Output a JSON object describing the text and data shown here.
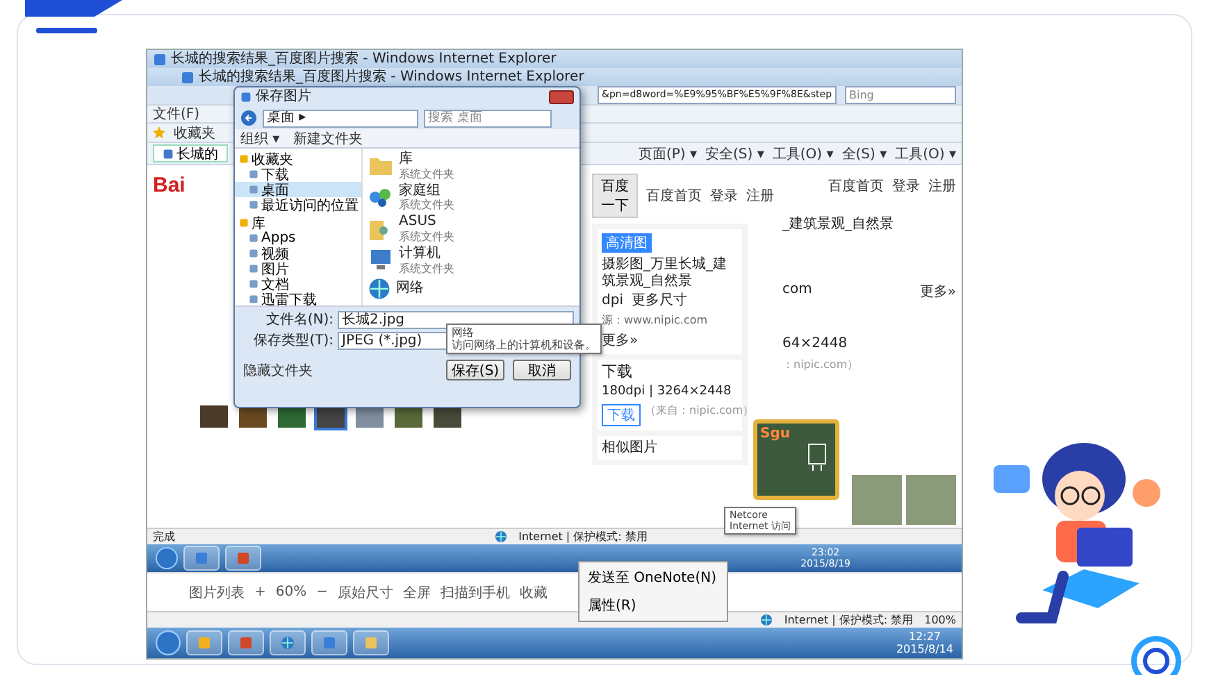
{
  "browser": {
    "titles": [
      "长城的搜索结果_百度图片搜索 - Windows Internet Explorer",
      "长城的搜索结果_百度图片搜索 - Windows Internet Explorer"
    ],
    "address": "&pn=d8word=%E9%95%BF%E5%9F%8E&step",
    "search_placeholder": "Bing",
    "menu": [
      "文件(F)"
    ],
    "favorites": "收藏夹",
    "tab": "长城的",
    "commands": [
      "页面(P) ▾",
      "安全(S) ▾",
      "工具(O) ▾"
    ],
    "commands_2": [
      "全(S) ▾",
      "工具(O) ▾"
    ]
  },
  "baidu": {
    "logo": "Bai",
    "search_button": "百度一下",
    "links": [
      "百度首页",
      "登录",
      "注册"
    ],
    "links_2": [
      "百度首页",
      "登录",
      "注册"
    ]
  },
  "thumbnails": [
    {
      "selected": false
    },
    {
      "selected": false
    },
    {
      "selected": false
    },
    {
      "selected": true
    },
    {
      "selected": false
    },
    {
      "selected": false
    },
    {
      "selected": false
    }
  ],
  "detail": {
    "badge": "高清图",
    "title": "摄影图_万里长城_建筑景观_自然景",
    "meta": [
      "dpi",
      "更多尺寸"
    ],
    "source": "源：www.nipic.com",
    "more": "更多»",
    "download_heading": "下载",
    "specs": "180dpi | 3264×2448",
    "download_button": "下载",
    "from": "（来自：nipic.com）",
    "similar": "相似图片"
  },
  "right_panel": {
    "title": "_建筑景观_自然景",
    "source": "com",
    "more": "更多»",
    "specs": "64×2448",
    "from": "：nipic.com）"
  },
  "widget": {
    "logo": "Sgu"
  },
  "dialog": {
    "title": "保存图片",
    "path": "桌面 ▸",
    "search_placeholder": "搜索 桌面",
    "organize": "组织 ▾",
    "new_folder": "新建文件夹",
    "nav": [
      {
        "label": "收藏夹",
        "kind": "header",
        "selected": false
      },
      {
        "label": "下载",
        "kind": "item",
        "selected": false
      },
      {
        "label": "桌面",
        "kind": "item",
        "selected": true
      },
      {
        "label": "最近访问的位置",
        "kind": "item",
        "selected": false
      },
      {
        "label": "库",
        "kind": "header",
        "selected": false
      },
      {
        "label": "Apps",
        "kind": "item",
        "selected": false
      },
      {
        "label": "视频",
        "kind": "item",
        "selected": false
      },
      {
        "label": "图片",
        "kind": "item",
        "selected": false
      },
      {
        "label": "文档",
        "kind": "item",
        "selected": false
      },
      {
        "label": "迅雷下载",
        "kind": "item",
        "selected": false
      }
    ],
    "files": [
      {
        "name": "库",
        "type": "系统文件夹",
        "kind": "library"
      },
      {
        "name": "家庭组",
        "type": "系统文件夹",
        "kind": "homegroup"
      },
      {
        "name": "ASUS",
        "type": "系统文件夹",
        "kind": "user"
      },
      {
        "name": "计算机",
        "type": "系统文件夹",
        "kind": "computer"
      },
      {
        "name": "网络",
        "kind": "network"
      }
    ],
    "filename_label": "文件名(N):",
    "filename": "长城2.jpg",
    "type_label": "保存类型(T):",
    "type": "JPEG (*.jpg)",
    "tooltip": [
      "网络",
      "访问网络上的计算机和设备。"
    ],
    "hide_folders": "隐藏文件夹",
    "save": "保存(S)",
    "cancel": "取消"
  },
  "status": {
    "text": "完成",
    "zone": "Internet | 保护模式: 禁用"
  },
  "net_tooltip": [
    "Netcore",
    "Internet 访问"
  ],
  "inner_clock": [
    "23:02",
    "2015/8/19"
  ],
  "image_toolbar": [
    "图片列表",
    "+",
    "60%",
    "−",
    "原始尺寸",
    "全屏",
    "扫描到手机",
    "收藏"
  ],
  "context_menu": [
    "发送至 OneNote(N)",
    "属性(R)"
  ],
  "outer_status": {
    "zone": "Internet | 保护模式: 禁用",
    "zoom": "100%"
  },
  "outer_clock": [
    "12:27",
    "2015/8/14"
  ]
}
